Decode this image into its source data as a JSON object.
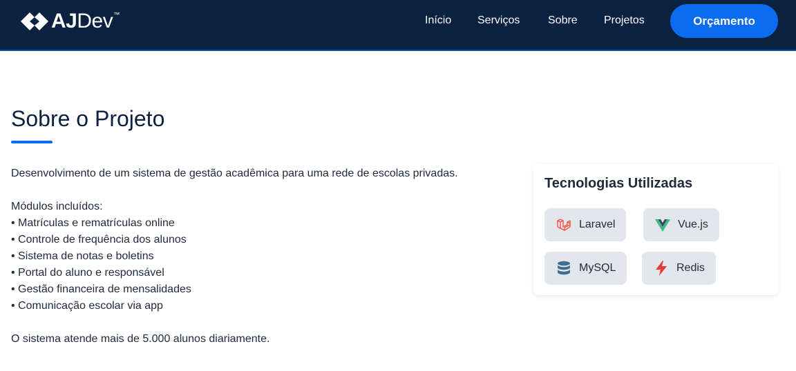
{
  "navbar": {
    "logo": {
      "bold": "AJ",
      "regular": "Dev",
      "tm": "™"
    },
    "links": [
      "Início",
      "Serviços",
      "Sobre",
      "Projetos"
    ],
    "cta_label": "Orçamento"
  },
  "project": {
    "title": "Sobre o Projeto",
    "intro": "Desenvolvimento de um sistema de gestão acadêmica para uma rede de escolas privadas.",
    "modules_heading": "Módulos incluídos:",
    "modules": [
      "• Matrículas e rematrículas online",
      "• Controle de frequência dos alunos",
      "• Sistema de notas e boletins",
      "• Portal do aluno e responsável",
      "• Gestão financeira de mensalidades",
      "• Comunicação escolar via app"
    ],
    "closing": "O sistema atende mais de 5.000 alunos diariamente."
  },
  "technologies": {
    "title": "Tecnologias Utilizadas",
    "items": [
      {
        "label": "Laravel",
        "icon": "laravel-icon",
        "color": "#f05340"
      },
      {
        "label": "Vue.js",
        "icon": "vuejs-icon",
        "color": "#42b883"
      },
      {
        "label": "MySQL",
        "icon": "database-icon",
        "color": "#3e6e93"
      },
      {
        "label": "Redis",
        "icon": "lightning-icon",
        "color": "#e53935"
      }
    ]
  },
  "colors": {
    "navbar_bg": "#0a2140",
    "accent": "#0b6cf0",
    "chip_bg": "#e3e6ea"
  }
}
